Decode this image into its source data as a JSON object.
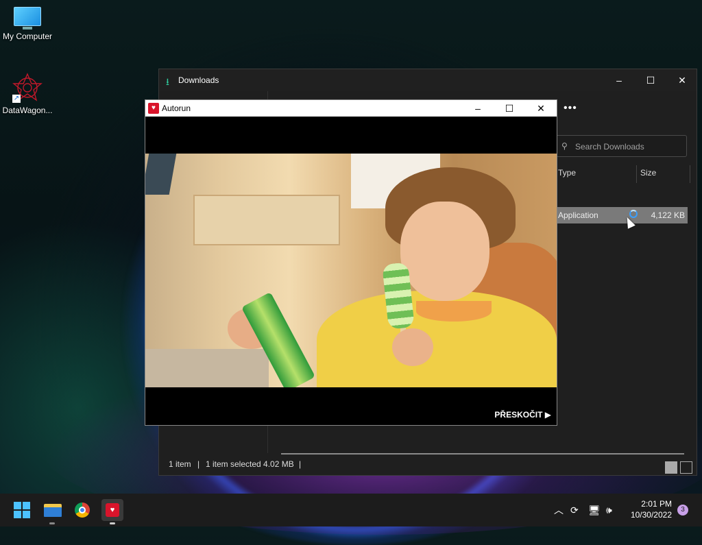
{
  "desktop": {
    "icons": [
      {
        "label": "My Computer"
      },
      {
        "label": "DataWagon..."
      }
    ]
  },
  "explorer": {
    "title": "Downloads",
    "search": {
      "placeholder": "Search Downloads"
    },
    "columns": {
      "type": "Type",
      "size": "Size"
    },
    "file": {
      "type": "Application",
      "size": "4,122 KB"
    },
    "status": {
      "items": "1 item",
      "selected": "1 item selected  4.02 MB",
      "sep": "|"
    }
  },
  "autorun": {
    "title": "Autorun",
    "skip_label": "PŘESKOČIT ▶"
  },
  "taskbar": {
    "clock_time": "2:01 PM",
    "clock_date": "10/30/2022",
    "notification_count": "3"
  },
  "colors": {
    "accent": "#4cc2ff",
    "downloads_icon": "#2fd0a0",
    "autorun_brand": "#d9142b"
  }
}
